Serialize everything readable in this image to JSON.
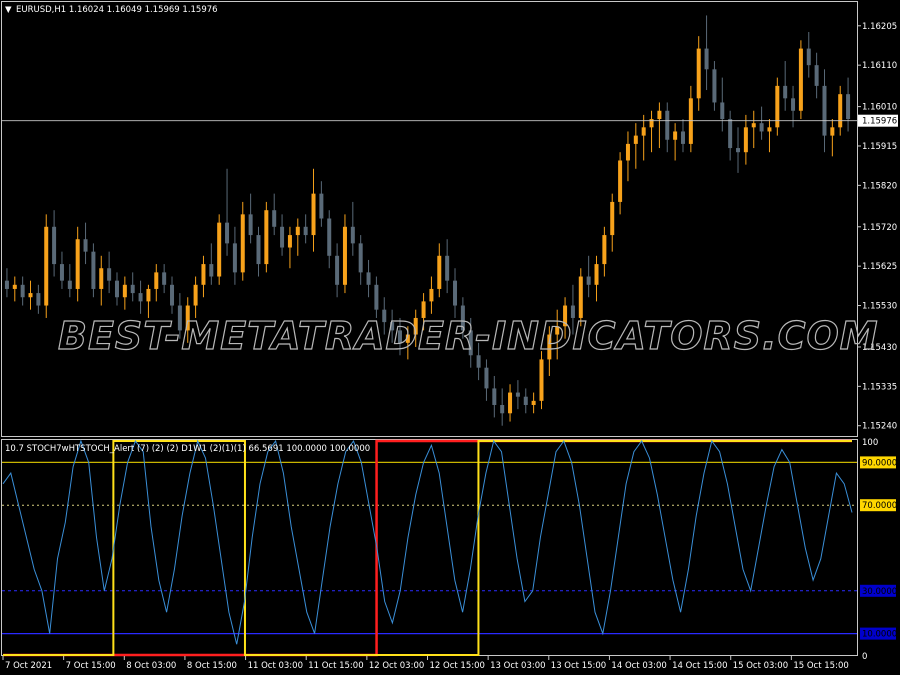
{
  "symbol_header": {
    "arrow": "▼",
    "text": "EURUSD,H1  1.16024 1.16049 1.15969 1.15976"
  },
  "indicator_header": {
    "text": "10.7 STOCH7wHTSTOCH_Alert (7) (2) (2) D1W1  (2)(1)(1) 66.5691 100.0000 100.0000"
  },
  "watermark": "BEST-METATRADER-INDICATORS.COM",
  "colors": {
    "background": "#000000",
    "bull_candle": "#f7a21b",
    "bear_candle": "#5a6a78",
    "grid_border": "#c8c8c8",
    "stoch_line": "#3a8fd8",
    "level_90": "#c8b400",
    "level_70": "#d8d080",
    "level_low": "#2a2aff",
    "step_red": "#ff1f1f",
    "step_yellow": "#ffe11a",
    "label_yellow_bg": "#ffd700",
    "label_blue_bg": "#0000cc"
  },
  "chart_data": [
    {
      "type": "candlestick",
      "symbol": "EURUSD",
      "timeframe": "H1",
      "ohlc_header": {
        "open": 1.16024,
        "high": 1.16049,
        "low": 1.15969,
        "close": 1.15976
      },
      "current_price": 1.15976,
      "ylim": [
        1.1522,
        1.1626
      ],
      "y_ticks": [
        "1.16205",
        "1.16110",
        "1.16010",
        "1.15915",
        "1.15820",
        "1.15720",
        "1.15625",
        "1.15530",
        "1.15430",
        "1.15335",
        "1.15240"
      ],
      "price_tag": "1.15976",
      "candles": [
        [
          1.1559,
          1.1562,
          1.1555,
          1.1557
        ],
        [
          1.1557,
          1.156,
          1.1554,
          1.1558
        ],
        [
          1.1558,
          1.156,
          1.1553,
          1.1555
        ],
        [
          1.1555,
          1.1559,
          1.1552,
          1.1556
        ],
        [
          1.1556,
          1.1558,
          1.1551,
          1.1553
        ],
        [
          1.1553,
          1.1575,
          1.155,
          1.1572
        ],
        [
          1.1572,
          1.1576,
          1.156,
          1.1563
        ],
        [
          1.1563,
          1.1566,
          1.1557,
          1.1559
        ],
        [
          1.1559,
          1.1563,
          1.1555,
          1.1557
        ],
        [
          1.1557,
          1.1572,
          1.1554,
          1.1569
        ],
        [
          1.1569,
          1.1573,
          1.1563,
          1.1566
        ],
        [
          1.1566,
          1.1568,
          1.1555,
          1.1557
        ],
        [
          1.1557,
          1.1565,
          1.1553,
          1.1562
        ],
        [
          1.1562,
          1.1566,
          1.1556,
          1.1559
        ],
        [
          1.1559,
          1.1561,
          1.1553,
          1.1555
        ],
        [
          1.1555,
          1.156,
          1.1552,
          1.1558
        ],
        [
          1.1558,
          1.1561,
          1.1554,
          1.1556
        ],
        [
          1.1556,
          1.1559,
          1.1551,
          1.1554
        ],
        [
          1.1554,
          1.1558,
          1.155,
          1.1557
        ],
        [
          1.1557,
          1.1563,
          1.1554,
          1.1561
        ],
        [
          1.1561,
          1.1563,
          1.1556,
          1.1558
        ],
        [
          1.1558,
          1.156,
          1.1551,
          1.1553
        ],
        [
          1.1553,
          1.1556,
          1.1545,
          1.1547
        ],
        [
          1.1547,
          1.1555,
          1.1544,
          1.1553
        ],
        [
          1.1553,
          1.156,
          1.155,
          1.1558
        ],
        [
          1.1558,
          1.1565,
          1.1555,
          1.1563
        ],
        [
          1.1563,
          1.1568,
          1.1558,
          1.156
        ],
        [
          1.156,
          1.1575,
          1.1558,
          1.1573
        ],
        [
          1.1573,
          1.1586,
          1.1565,
          1.1568
        ],
        [
          1.1568,
          1.1572,
          1.1558,
          1.1561
        ],
        [
          1.1561,
          1.1578,
          1.1559,
          1.1575
        ],
        [
          1.1575,
          1.158,
          1.1568,
          1.157
        ],
        [
          1.157,
          1.1572,
          1.156,
          1.1563
        ],
        [
          1.1563,
          1.1578,
          1.1561,
          1.1576
        ],
        [
          1.1576,
          1.158,
          1.157,
          1.1572
        ],
        [
          1.1572,
          1.1575,
          1.1565,
          1.1567
        ],
        [
          1.1567,
          1.1572,
          1.1562,
          1.157
        ],
        [
          1.157,
          1.1574,
          1.1565,
          1.1572
        ],
        [
          1.1572,
          1.1575,
          1.1568,
          1.157
        ],
        [
          1.157,
          1.1586,
          1.1566,
          1.158
        ],
        [
          1.158,
          1.1583,
          1.1572,
          1.1574
        ],
        [
          1.1574,
          1.1576,
          1.1562,
          1.1565
        ],
        [
          1.1565,
          1.1568,
          1.1555,
          1.1558
        ],
        [
          1.1558,
          1.1575,
          1.1556,
          1.1572
        ],
        [
          1.1572,
          1.1578,
          1.1565,
          1.1568
        ],
        [
          1.1568,
          1.157,
          1.1558,
          1.1561
        ],
        [
          1.1561,
          1.1564,
          1.1555,
          1.1558
        ],
        [
          1.1558,
          1.156,
          1.155,
          1.1552
        ],
        [
          1.1552,
          1.1555,
          1.1546,
          1.1549
        ],
        [
          1.1549,
          1.1552,
          1.1544,
          1.1547
        ],
        [
          1.1547,
          1.155,
          1.1541,
          1.1544
        ],
        [
          1.1544,
          1.1548,
          1.154,
          1.1546
        ],
        [
          1.1546,
          1.1552,
          1.1543,
          1.155
        ],
        [
          1.155,
          1.1556,
          1.1547,
          1.1554
        ],
        [
          1.1554,
          1.156,
          1.1551,
          1.1557
        ],
        [
          1.1557,
          1.1568,
          1.1555,
          1.1565
        ],
        [
          1.1565,
          1.1569,
          1.1556,
          1.1559
        ],
        [
          1.1559,
          1.1562,
          1.155,
          1.1553
        ],
        [
          1.1553,
          1.1555,
          1.1545,
          1.1547
        ],
        [
          1.1547,
          1.155,
          1.1538,
          1.1541
        ],
        [
          1.1541,
          1.1544,
          1.1535,
          1.1538
        ],
        [
          1.1538,
          1.154,
          1.153,
          1.1533
        ],
        [
          1.1533,
          1.1536,
          1.1526,
          1.1529
        ],
        [
          1.1529,
          1.1533,
          1.1524,
          1.1527
        ],
        [
          1.1527,
          1.1534,
          1.1525,
          1.1532
        ],
        [
          1.1532,
          1.1535,
          1.1528,
          1.1531
        ],
        [
          1.1531,
          1.1533,
          1.1527,
          1.1529
        ],
        [
          1.1529,
          1.1532,
          1.1527,
          1.153
        ],
        [
          1.153,
          1.1542,
          1.1528,
          1.154
        ],
        [
          1.154,
          1.1548,
          1.1536,
          1.1546
        ],
        [
          1.1546,
          1.1552,
          1.154,
          1.1548
        ],
        [
          1.1548,
          1.1555,
          1.1545,
          1.1553
        ],
        [
          1.1553,
          1.1558,
          1.1546,
          1.155
        ],
        [
          1.155,
          1.1562,
          1.1548,
          1.156
        ],
        [
          1.156,
          1.1565,
          1.1555,
          1.1558
        ],
        [
          1.1558,
          1.1565,
          1.1554,
          1.1563
        ],
        [
          1.1563,
          1.1572,
          1.156,
          1.157
        ],
        [
          1.157,
          1.158,
          1.1566,
          1.1578
        ],
        [
          1.1578,
          1.159,
          1.1575,
          1.1588
        ],
        [
          1.1588,
          1.1595,
          1.1583,
          1.1592
        ],
        [
          1.1592,
          1.1597,
          1.1586,
          1.1594
        ],
        [
          1.1594,
          1.1599,
          1.1588,
          1.1596
        ],
        [
          1.1596,
          1.16,
          1.159,
          1.1598
        ],
        [
          1.1598,
          1.1602,
          1.1591,
          1.16
        ],
        [
          1.16,
          1.1602,
          1.159,
          1.1593
        ],
        [
          1.1593,
          1.1597,
          1.1588,
          1.1595
        ],
        [
          1.1595,
          1.1598,
          1.159,
          1.1592
        ],
        [
          1.1592,
          1.1606,
          1.159,
          1.1603
        ],
        [
          1.1603,
          1.1618,
          1.16,
          1.1615
        ],
        [
          1.1615,
          1.1623,
          1.1605,
          1.161
        ],
        [
          1.161,
          1.1612,
          1.16,
          1.1602
        ],
        [
          1.1602,
          1.1608,
          1.1595,
          1.1598
        ],
        [
          1.1598,
          1.16,
          1.1588,
          1.1591
        ],
        [
          1.1591,
          1.1596,
          1.1585,
          1.159
        ],
        [
          1.159,
          1.1599,
          1.1587,
          1.1596
        ],
        [
          1.1596,
          1.16,
          1.1591,
          1.1597
        ],
        [
          1.1597,
          1.1601,
          1.1593,
          1.1595
        ],
        [
          1.1595,
          1.1598,
          1.159,
          1.1596
        ],
        [
          1.1596,
          1.1608,
          1.1594,
          1.1606
        ],
        [
          1.1606,
          1.1612,
          1.16,
          1.1603
        ],
        [
          1.1603,
          1.1606,
          1.1596,
          1.16
        ],
        [
          1.16,
          1.1617,
          1.1598,
          1.1615
        ],
        [
          1.1615,
          1.1619,
          1.1608,
          1.1611
        ],
        [
          1.1611,
          1.1614,
          1.1603,
          1.1606
        ],
        [
          1.1606,
          1.161,
          1.159,
          1.1594
        ],
        [
          1.1594,
          1.1598,
          1.1589,
          1.1596
        ],
        [
          1.1596,
          1.1606,
          1.1594,
          1.1604
        ],
        [
          1.1604,
          1.1608,
          1.1595,
          1.1598
        ]
      ]
    },
    {
      "type": "line",
      "indicator": "STOCH7wHTSTOCH_Alert",
      "ylim": [
        0,
        100
      ],
      "y_ticks": [
        "100",
        "0"
      ],
      "levels": [
        {
          "value": 90,
          "label": "90.0000"
        },
        {
          "value": 70,
          "label": "70.0000"
        },
        {
          "value": 30,
          "label": "30.0000"
        },
        {
          "value": 10,
          "label": "10.0000"
        }
      ],
      "stoch_values": [
        80,
        85,
        70,
        55,
        40,
        30,
        10,
        45,
        62,
        88,
        100,
        90,
        55,
        30,
        45,
        70,
        90,
        100,
        95,
        60,
        35,
        20,
        40,
        65,
        85,
        100,
        92,
        70,
        45,
        20,
        5,
        25,
        55,
        80,
        95,
        100,
        85,
        60,
        40,
        20,
        10,
        35,
        60,
        80,
        95,
        100,
        90,
        70,
        50,
        25,
        15,
        30,
        55,
        75,
        90,
        98,
        85,
        60,
        35,
        20,
        40,
        65,
        85,
        100,
        95,
        70,
        45,
        25,
        30,
        55,
        75,
        95,
        100,
        90,
        70,
        45,
        20,
        10,
        30,
        55,
        80,
        95,
        100,
        92,
        75,
        55,
        35,
        20,
        40,
        65,
        85,
        100,
        95,
        80,
        60,
        40,
        30,
        50,
        70,
        88,
        96,
        90,
        70,
        50,
        35,
        45,
        65,
        85,
        80,
        66.5691
      ],
      "step_red": [
        {
          "from": 0,
          "to": 0.44,
          "value": 0
        },
        {
          "from": 0.44,
          "to": 1,
          "value": 100
        }
      ],
      "step_yellow": [
        {
          "from": 0,
          "to": 0.13,
          "value": 0
        },
        {
          "from": 0.13,
          "to": 0.285,
          "value": 100
        },
        {
          "from": 0.285,
          "to": 0.56,
          "value": 0
        },
        {
          "from": 0.56,
          "to": 1,
          "value": 100
        }
      ],
      "x_labels": [
        "7 Oct 2021",
        "7 Oct 15:00",
        "8 Oct 03:00",
        "8 Oct 15:00",
        "11 Oct 03:00",
        "11 Oct 15:00",
        "12 Oct 03:00",
        "12 Oct 15:00",
        "13 Oct 03:00",
        "13 Oct 15:00",
        "14 Oct 03:00",
        "14 Oct 15:00",
        "15 Oct 03:00",
        "15 Oct 15:00"
      ]
    }
  ]
}
